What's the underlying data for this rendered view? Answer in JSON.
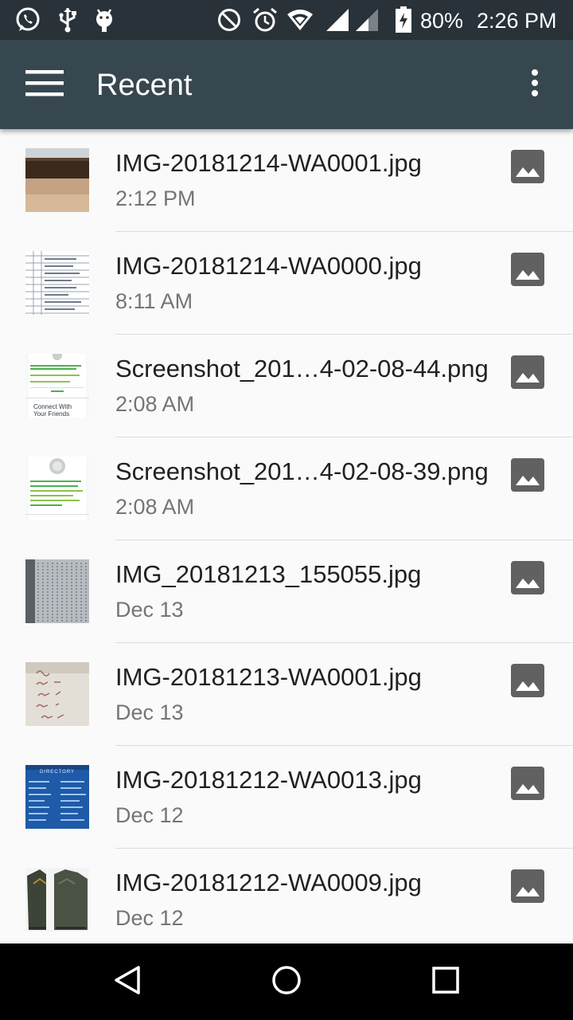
{
  "status_bar": {
    "notification_icons": [
      "whatsapp-icon",
      "usb-icon",
      "android-debug-icon"
    ],
    "system_icons": [
      "do-not-disturb-icon",
      "alarm-icon",
      "wifi-icon",
      "cell-signal-icon",
      "cell-signal-2-icon",
      "battery-charging-icon"
    ],
    "battery": "80%",
    "time": "2:26 PM"
  },
  "app_bar": {
    "title": "Recent",
    "menu_icon": "hamburger-menu-icon",
    "overflow_icon": "more-vert-icon",
    "background": "#37474f"
  },
  "files": [
    {
      "name": "IMG-20181214-WA0001.jpg",
      "date": "2:12 PM",
      "type_icon": "image-icon"
    },
    {
      "name": "IMG-20181214-WA0000.jpg",
      "date": "8:11 AM",
      "type_icon": "image-icon"
    },
    {
      "name": "Screenshot_201…4-02-08-44.png",
      "date": "2:08 AM",
      "type_icon": "image-icon",
      "thumb_text": "Connect With Your Friends"
    },
    {
      "name": "Screenshot_201…4-02-08-39.png",
      "date": "2:08 AM",
      "type_icon": "image-icon"
    },
    {
      "name": "IMG_20181213_155055.jpg",
      "date": "Dec 13",
      "type_icon": "image-icon"
    },
    {
      "name": "IMG-20181213-WA0001.jpg",
      "date": "Dec 13",
      "type_icon": "image-icon"
    },
    {
      "name": "IMG-20181212-WA0013.jpg",
      "date": "Dec 12",
      "type_icon": "image-icon",
      "thumb_text": "DIRECTORY"
    },
    {
      "name": "IMG-20181212-WA0009.jpg",
      "date": "Dec 12",
      "type_icon": "image-icon"
    }
  ],
  "nav_bar": {
    "icons": [
      "back-icon",
      "home-icon",
      "recents-icon"
    ]
  }
}
